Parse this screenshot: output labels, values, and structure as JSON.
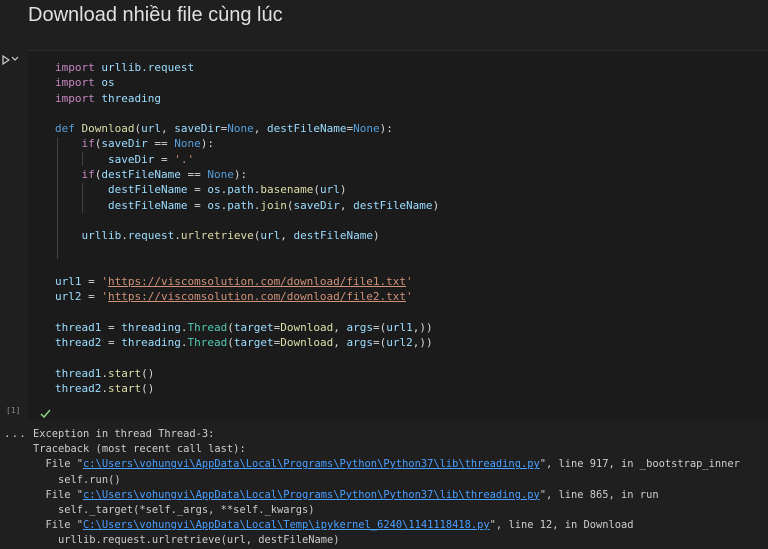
{
  "title": "Download nhiều file cùng lúc",
  "cell": {
    "exec_count": "[1]",
    "lines": [
      [
        {
          "t": "import",
          "c": "kw"
        },
        {
          "t": " urllib.request",
          "c": "var"
        }
      ],
      [
        {
          "t": "import",
          "c": "kw"
        },
        {
          "t": " os",
          "c": "var"
        }
      ],
      [
        {
          "t": "import",
          "c": "kw"
        },
        {
          "t": " threading",
          "c": "var"
        }
      ],
      [],
      [
        {
          "t": "def ",
          "c": "const"
        },
        {
          "t": "Download",
          "c": "fn"
        },
        {
          "t": "(",
          "c": "op"
        },
        {
          "t": "url",
          "c": "var"
        },
        {
          "t": ", ",
          "c": "op"
        },
        {
          "t": "saveDir",
          "c": "var"
        },
        {
          "t": "=",
          "c": "op"
        },
        {
          "t": "None",
          "c": "const"
        },
        {
          "t": ", ",
          "c": "op"
        },
        {
          "t": "destFileName",
          "c": "var"
        },
        {
          "t": "=",
          "c": "op"
        },
        {
          "t": "None",
          "c": "const"
        },
        {
          "t": "):",
          "c": "op"
        }
      ],
      [
        {
          "t": "    ",
          "c": "op"
        },
        {
          "t": "if",
          "c": "kw"
        },
        {
          "t": "(",
          "c": "op"
        },
        {
          "t": "saveDir",
          "c": "var"
        },
        {
          "t": " == ",
          "c": "op"
        },
        {
          "t": "None",
          "c": "const"
        },
        {
          "t": "):",
          "c": "op"
        }
      ],
      [
        {
          "t": "        ",
          "c": "op"
        },
        {
          "t": "saveDir",
          "c": "var"
        },
        {
          "t": " = ",
          "c": "op"
        },
        {
          "t": "'.'",
          "c": "str"
        }
      ],
      [
        {
          "t": "    ",
          "c": "op"
        },
        {
          "t": "if",
          "c": "kw"
        },
        {
          "t": "(",
          "c": "op"
        },
        {
          "t": "destFileName",
          "c": "var"
        },
        {
          "t": " == ",
          "c": "op"
        },
        {
          "t": "None",
          "c": "const"
        },
        {
          "t": "):",
          "c": "op"
        }
      ],
      [
        {
          "t": "        ",
          "c": "op"
        },
        {
          "t": "destFileName",
          "c": "var"
        },
        {
          "t": " = ",
          "c": "op"
        },
        {
          "t": "os",
          "c": "var"
        },
        {
          "t": ".",
          "c": "op"
        },
        {
          "t": "path",
          "c": "var"
        },
        {
          "t": ".",
          "c": "op"
        },
        {
          "t": "basename",
          "c": "fn"
        },
        {
          "t": "(",
          "c": "op"
        },
        {
          "t": "url",
          "c": "var"
        },
        {
          "t": ")",
          "c": "op"
        }
      ],
      [
        {
          "t": "        ",
          "c": "op"
        },
        {
          "t": "destFileName",
          "c": "var"
        },
        {
          "t": " = ",
          "c": "op"
        },
        {
          "t": "os",
          "c": "var"
        },
        {
          "t": ".",
          "c": "op"
        },
        {
          "t": "path",
          "c": "var"
        },
        {
          "t": ".",
          "c": "op"
        },
        {
          "t": "join",
          "c": "fn"
        },
        {
          "t": "(",
          "c": "op"
        },
        {
          "t": "saveDir",
          "c": "var"
        },
        {
          "t": ", ",
          "c": "op"
        },
        {
          "t": "destFileName",
          "c": "var"
        },
        {
          "t": ")",
          "c": "op"
        }
      ],
      [],
      [
        {
          "t": "    ",
          "c": "op"
        },
        {
          "t": "urllib",
          "c": "var"
        },
        {
          "t": ".",
          "c": "op"
        },
        {
          "t": "request",
          "c": "var"
        },
        {
          "t": ".",
          "c": "op"
        },
        {
          "t": "urlretrieve",
          "c": "fn"
        },
        {
          "t": "(",
          "c": "op"
        },
        {
          "t": "url",
          "c": "var"
        },
        {
          "t": ", ",
          "c": "op"
        },
        {
          "t": "destFileName",
          "c": "var"
        },
        {
          "t": ")",
          "c": "op"
        }
      ],
      [],
      [],
      [
        {
          "t": "url1",
          "c": "var"
        },
        {
          "t": " = ",
          "c": "op"
        },
        {
          "t": "'",
          "c": "str"
        },
        {
          "t": "https://viscomsolution.com/download/file1.txt",
          "c": "url"
        },
        {
          "t": "'",
          "c": "str"
        }
      ],
      [
        {
          "t": "url2",
          "c": "var"
        },
        {
          "t": " = ",
          "c": "op"
        },
        {
          "t": "'",
          "c": "str"
        },
        {
          "t": "https://viscomsolution.com/download/file2.txt",
          "c": "url"
        },
        {
          "t": "'",
          "c": "str"
        }
      ],
      [],
      [
        {
          "t": "thread1",
          "c": "var"
        },
        {
          "t": " = ",
          "c": "op"
        },
        {
          "t": "threading",
          "c": "var"
        },
        {
          "t": ".",
          "c": "op"
        },
        {
          "t": "Thread",
          "c": "mod"
        },
        {
          "t": "(",
          "c": "op"
        },
        {
          "t": "target",
          "c": "var"
        },
        {
          "t": "=",
          "c": "op"
        },
        {
          "t": "Download",
          "c": "fn"
        },
        {
          "t": ", ",
          "c": "op"
        },
        {
          "t": "args",
          "c": "var"
        },
        {
          "t": "=(",
          "c": "op"
        },
        {
          "t": "url1",
          "c": "var"
        },
        {
          "t": ",))",
          "c": "op"
        }
      ],
      [
        {
          "t": "thread2",
          "c": "var"
        },
        {
          "t": " = ",
          "c": "op"
        },
        {
          "t": "threading",
          "c": "var"
        },
        {
          "t": ".",
          "c": "op"
        },
        {
          "t": "Thread",
          "c": "mod"
        },
        {
          "t": "(",
          "c": "op"
        },
        {
          "t": "target",
          "c": "var"
        },
        {
          "t": "=",
          "c": "op"
        },
        {
          "t": "Download",
          "c": "fn"
        },
        {
          "t": ", ",
          "c": "op"
        },
        {
          "t": "args",
          "c": "var"
        },
        {
          "t": "=(",
          "c": "op"
        },
        {
          "t": "url2",
          "c": "var"
        },
        {
          "t": ",))",
          "c": "op"
        }
      ],
      [],
      [
        {
          "t": "thread1",
          "c": "var"
        },
        {
          "t": ".",
          "c": "op"
        },
        {
          "t": "start",
          "c": "fn"
        },
        {
          "t": "()",
          "c": "op"
        }
      ],
      [
        {
          "t": "thread2",
          "c": "var"
        },
        {
          "t": ".",
          "c": "op"
        },
        {
          "t": "start",
          "c": "fn"
        },
        {
          "t": "()",
          "c": "op"
        }
      ]
    ]
  },
  "output": {
    "dots": "...",
    "lines": [
      [
        {
          "t": "Exception in thread Thread-3:",
          "c": "tline"
        }
      ],
      [
        {
          "t": "Traceback (most recent call last):",
          "c": "tline"
        }
      ],
      [
        {
          "t": "  File \"",
          "c": "tline"
        },
        {
          "t": "c:\\Users\\vohungvi\\AppData\\Local\\Programs\\Python\\Python37\\lib\\threading.py",
          "c": "tlink"
        },
        {
          "t": "\", line 917, in _bootstrap_inner",
          "c": "tline"
        }
      ],
      [
        {
          "t": "    self.run()",
          "c": "tline"
        }
      ],
      [
        {
          "t": "  File \"",
          "c": "tline"
        },
        {
          "t": "c:\\Users\\vohungvi\\AppData\\Local\\Programs\\Python\\Python37\\lib\\threading.py",
          "c": "tlink"
        },
        {
          "t": "\", line 865, in run",
          "c": "tline"
        }
      ],
      [
        {
          "t": "    self._target(*self._args, **self._kwargs)",
          "c": "tline"
        }
      ],
      [
        {
          "t": "  File \"",
          "c": "tline"
        },
        {
          "t": "C:\\Users\\vohungvi\\AppData\\Local\\Temp\\ipykernel_6240\\1141118418.py",
          "c": "tlink"
        },
        {
          "t": "\", line 12, in Download",
          "c": "tline"
        }
      ],
      [
        {
          "t": "    urllib.request.urlretrieve(url, destFileName)",
          "c": "tline"
        }
      ]
    ]
  }
}
